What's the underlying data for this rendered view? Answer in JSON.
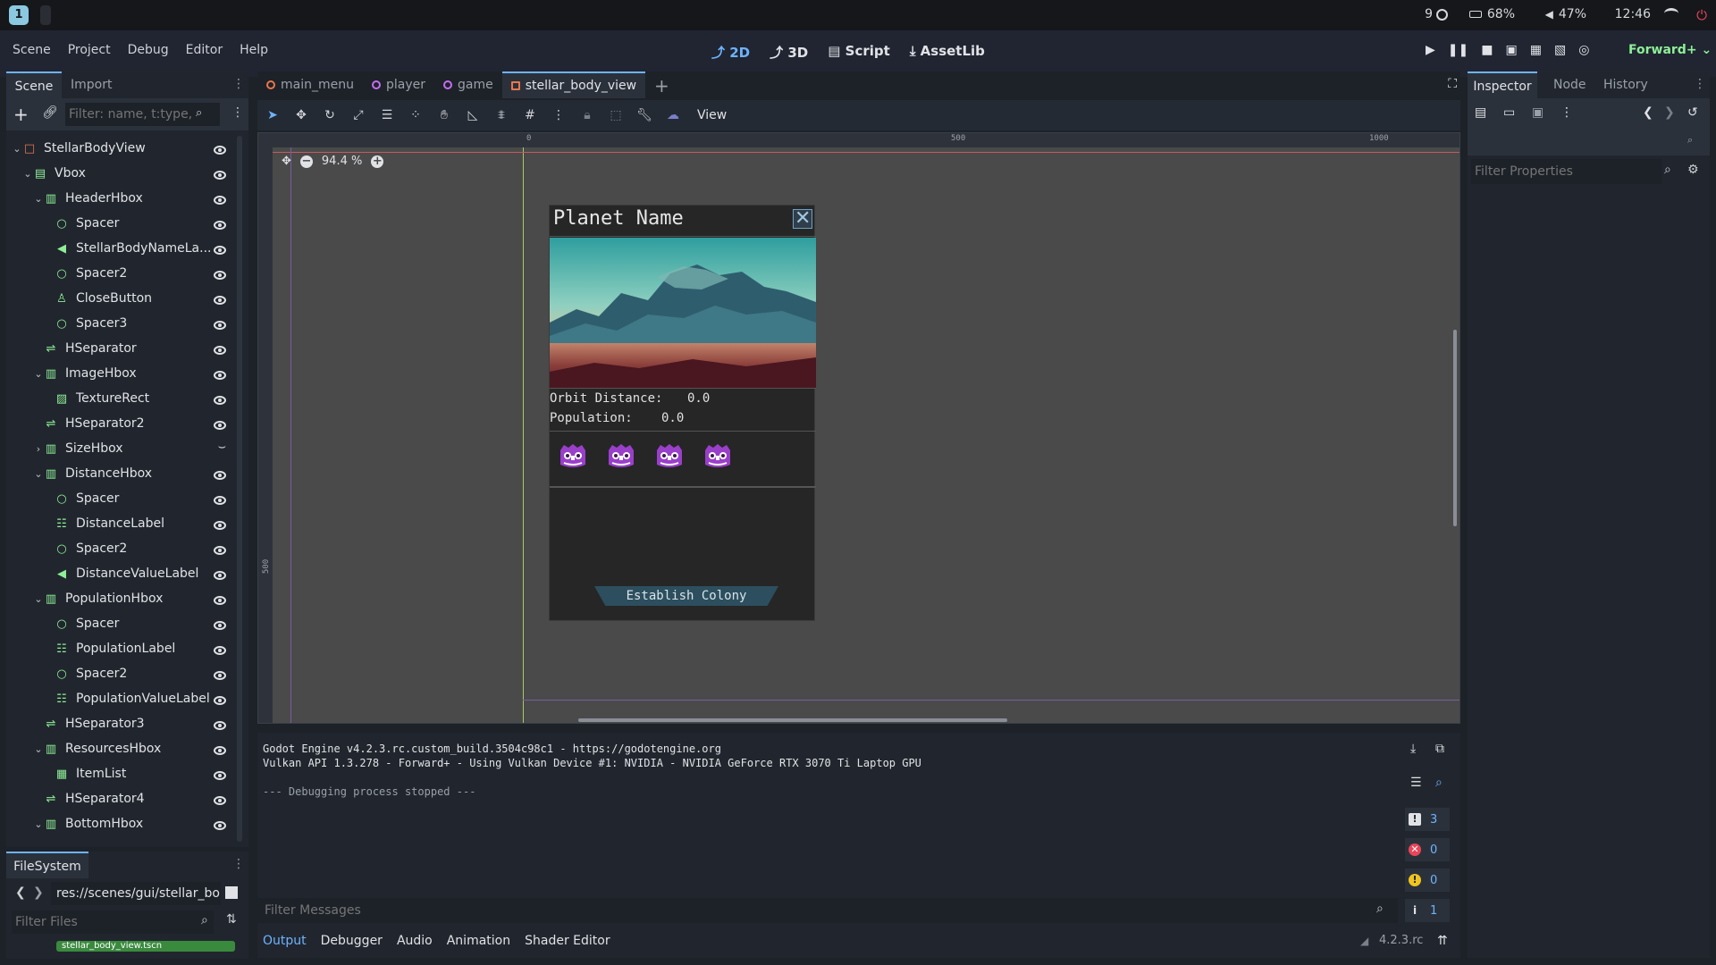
{
  "system_bar": {
    "workspace": "1",
    "notif_count": "9",
    "battery": "68%",
    "volume": "47%",
    "clock": "12:46"
  },
  "menu": [
    "Scene",
    "Project",
    "Debug",
    "Editor",
    "Help"
  ],
  "workspaces": {
    "w2d": "2D",
    "w3d": "3D",
    "script": "Script",
    "assetlib": "AssetLib"
  },
  "renderer": "Forward+",
  "left_dock": {
    "tabs": [
      "Scene",
      "Import"
    ],
    "filter_placeholder": "Filter: name, t:type,",
    "tree": [
      {
        "label": "StellarBodyView",
        "icon": "control-node-icon"
      },
      {
        "label": "Vbox",
        "icon": "vbox-icon"
      },
      {
        "label": "HeaderHbox",
        "icon": "hbox-icon"
      },
      {
        "label": "Spacer",
        "icon": "control-circle-icon"
      },
      {
        "label": "StellarBodyNameLa...",
        "icon": "label-icon"
      },
      {
        "label": "Spacer2",
        "icon": "control-circle-icon"
      },
      {
        "label": "CloseButton",
        "icon": "button-icon"
      },
      {
        "label": "Spacer3",
        "icon": "control-circle-icon"
      },
      {
        "label": "HSeparator",
        "icon": "separator-icon"
      },
      {
        "label": "ImageHbox",
        "icon": "hbox-icon"
      },
      {
        "label": "TextureRect",
        "icon": "texture-rect-icon"
      },
      {
        "label": "HSeparator2",
        "icon": "separator-icon"
      },
      {
        "label": "SizeHbox",
        "icon": "hbox-icon"
      },
      {
        "label": "DistanceHbox",
        "icon": "hbox-icon"
      },
      {
        "label": "Spacer",
        "icon": "control-circle-icon"
      },
      {
        "label": "DistanceLabel",
        "icon": "rich-label-icon"
      },
      {
        "label": "Spacer2",
        "icon": "control-circle-icon"
      },
      {
        "label": "DistanceValueLabel",
        "icon": "label-icon"
      },
      {
        "label": "PopulationHbox",
        "icon": "hbox-icon"
      },
      {
        "label": "Spacer",
        "icon": "control-circle-icon"
      },
      {
        "label": "PopulationLabel",
        "icon": "rich-label-icon"
      },
      {
        "label": "Spacer2",
        "icon": "control-circle-icon"
      },
      {
        "label": "PopulationValueLabel",
        "icon": "rich-label-icon"
      },
      {
        "label": "HSeparator3",
        "icon": "separator-icon"
      },
      {
        "label": "ResourcesHbox",
        "icon": "hbox-icon"
      },
      {
        "label": "ItemList",
        "icon": "item-list-icon"
      },
      {
        "label": "HSeparator4",
        "icon": "separator-icon"
      },
      {
        "label": "BottomHbox",
        "icon": "hbox-icon"
      }
    ],
    "filesystem_title": "FileSystem",
    "fs_path": "res://scenes/gui/stellar_bo",
    "fs_filter_placeholder": "Filter Files",
    "fs_file": "stellar_body_view.tscn"
  },
  "scene_tabs": [
    {
      "label": "main_menu",
      "color": "#e8774c"
    },
    {
      "label": "player",
      "color": "#c56ef2"
    },
    {
      "label": "game",
      "color": "#c56ef2"
    },
    {
      "label": "stellar_body_view",
      "color": "#e8774c"
    }
  ],
  "toolbar": {
    "view_label": "View"
  },
  "viewport": {
    "zoom": "94.4 %",
    "ruler_labels": [
      "0",
      "500",
      "1000"
    ],
    "ruler_v_label": "500",
    "panel": {
      "title": "Planet Name",
      "distance_label": "Orbit Distance:",
      "distance_value": "0.0",
      "population_label": "Population:",
      "population_value": "0.0",
      "resource_count": 4,
      "button": "Establish Colony"
    }
  },
  "output": {
    "lines": [
      "Godot Engine v4.2.3.rc.custom_build.3504c98c1 - https://godotengine.org",
      "Vulkan API 1.3.278 - Forward+ - Using Vulkan Device #1: NVIDIA - NVIDIA GeForce RTX 3070 Ti Laptop GPU",
      "",
      "--- Debugging process stopped ---"
    ],
    "counts": {
      "messages": "3",
      "errors": "0",
      "warnings": "0",
      "info": "1"
    },
    "filter_placeholder": "Filter Messages",
    "bottom_tabs": [
      "Output",
      "Debugger",
      "Audio",
      "Animation",
      "Shader Editor"
    ],
    "version": "4.2.3.rc"
  },
  "inspector": {
    "tabs": [
      "Inspector",
      "Node",
      "History"
    ],
    "filter_placeholder": "Filter Properties"
  }
}
